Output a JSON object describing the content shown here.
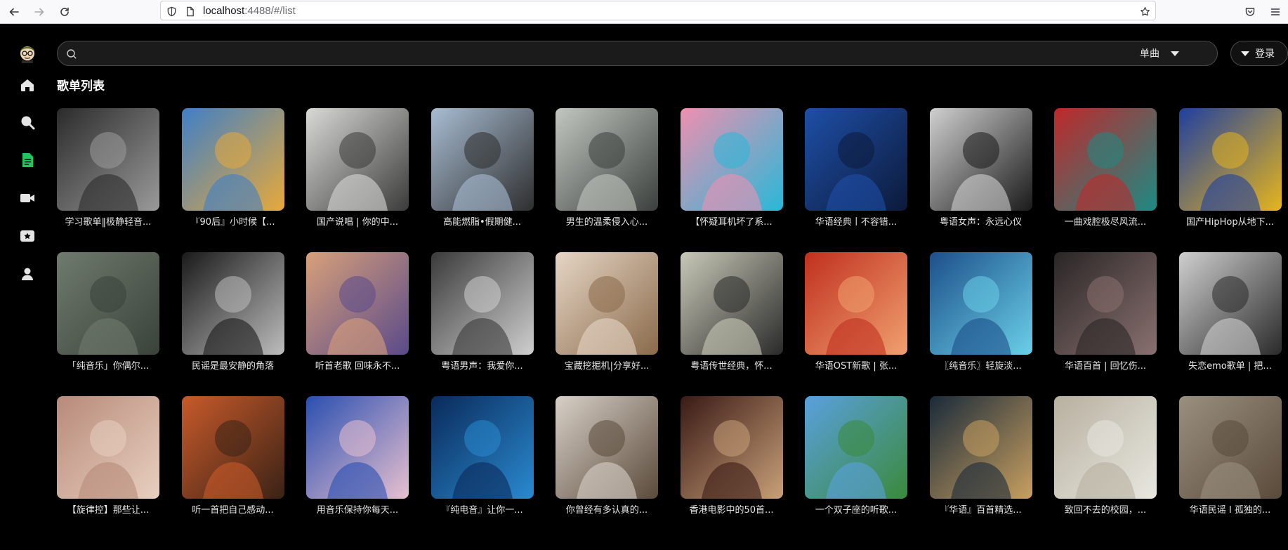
{
  "browser": {
    "url_host": "localhost",
    "url_rest": ":4488/#/list"
  },
  "sidebar": {
    "items": [
      {
        "name": "home-icon",
        "active": false
      },
      {
        "name": "search-icon",
        "active": false
      },
      {
        "name": "playlist-icon",
        "active": true
      },
      {
        "name": "video-icon",
        "active": false
      },
      {
        "name": "favorites-icon",
        "active": false
      },
      {
        "name": "user-icon",
        "active": false
      }
    ],
    "active_color": "#22c55e",
    "icon_color": "#e5e5e5"
  },
  "search": {
    "placeholder": "",
    "type_label": "单曲"
  },
  "header": {
    "login_label": "登录"
  },
  "page": {
    "title": "歌单列表"
  },
  "playlists": [
    {
      "title": "学习歌单‖极静轻音...",
      "colors": [
        "#2b2b2b",
        "#9a9a9a"
      ]
    },
    {
      "title": "『90后』小时候【...",
      "colors": [
        "#3f7fc7",
        "#e8a93a"
      ]
    },
    {
      "title": "国产说唱 | 你的中...",
      "colors": [
        "#d9d9d6",
        "#3b3b3b"
      ]
    },
    {
      "title": "高能燃脂•假期健...",
      "colors": [
        "#a8bdd3",
        "#2e2e2e"
      ]
    },
    {
      "title": "男生的温柔侵入心...",
      "colors": [
        "#c2c7c0",
        "#3a3f3d"
      ]
    },
    {
      "title": "【怀疑耳机坏了系...",
      "colors": [
        "#f08fb0",
        "#28b8d8"
      ]
    },
    {
      "title": "华语经典丨不容错...",
      "colors": [
        "#1e4fa8",
        "#0c1a3a"
      ]
    },
    {
      "title": "粤语女声：永远心仪",
      "colors": [
        "#d0d0d0",
        "#1a1a1a"
      ]
    },
    {
      "title": "一曲戏腔极尽风流...",
      "colors": [
        "#c0282a",
        "#1d8a84"
      ]
    },
    {
      "title": "国产HipHop从地下...",
      "colors": [
        "#1f3fa0",
        "#e6b51e"
      ]
    },
    {
      "title": "「纯音乐」你偶尔...",
      "colors": [
        "#6f7b6e",
        "#3a423a"
      ]
    },
    {
      "title": "民谣是最安静的角落",
      "colors": [
        "#1a1a1a",
        "#bdbdbd"
      ]
    },
    {
      "title": "听首老歌 回味永不...",
      "colors": [
        "#d8a07a",
        "#5a4a8a"
      ]
    },
    {
      "title": "粤语男声：我爱你...",
      "colors": [
        "#3a3a3a",
        "#cfcfcf"
      ]
    },
    {
      "title": "宝藏挖掘机|分享好...",
      "colors": [
        "#e6d6c6",
        "#8a6a4a"
      ]
    },
    {
      "title": "粤语传世经典，怀...",
      "colors": [
        "#c9c9b8",
        "#2a2a2a"
      ]
    },
    {
      "title": "华语OST新歌 | 张...",
      "colors": [
        "#c0301e",
        "#f0a070"
      ]
    },
    {
      "title": "〖纯音乐〗轻旋淡...",
      "colors": [
        "#1d4f8a",
        "#6ad0e8"
      ]
    },
    {
      "title": "华语百首 | 回忆伤...",
      "colors": [
        "#2a2626",
        "#8a7070"
      ]
    },
    {
      "title": "失恋emo歌单 | 把...",
      "colors": [
        "#cfcfcf",
        "#2a2a2a"
      ]
    },
    {
      "title": "【旋律控】那些让...",
      "colors": [
        "#b88a7a",
        "#e8d0c0"
      ]
    },
    {
      "title": "听一首把自己感动...",
      "colors": [
        "#c85a2a",
        "#3a2216"
      ]
    },
    {
      "title": "用音乐保持你每天...",
      "colors": [
        "#2a4fb0",
        "#e8c0d0"
      ]
    },
    {
      "title": "『纯电音』让你一...",
      "colors": [
        "#0a2a5a",
        "#2a8ad0"
      ]
    },
    {
      "title": "你曾经有多认真的...",
      "colors": [
        "#d8d0c8",
        "#5a4a3a"
      ]
    },
    {
      "title": "香港电影中的50首...",
      "colors": [
        "#3a1a16",
        "#c8a078"
      ]
    },
    {
      "title": "一个双子座的听歌...",
      "colors": [
        "#5aa0e0",
        "#3a8a3a"
      ]
    },
    {
      "title": "『华语』百首精选...",
      "colors": [
        "#1a2a3a",
        "#c8a060"
      ]
    },
    {
      "title": "致回不去的校园，...",
      "colors": [
        "#b8b0a0",
        "#e8e8e0"
      ]
    },
    {
      "title": "华语民谣 I 孤独的...",
      "colors": [
        "#9a9080",
        "#5a4a3a"
      ]
    }
  ]
}
